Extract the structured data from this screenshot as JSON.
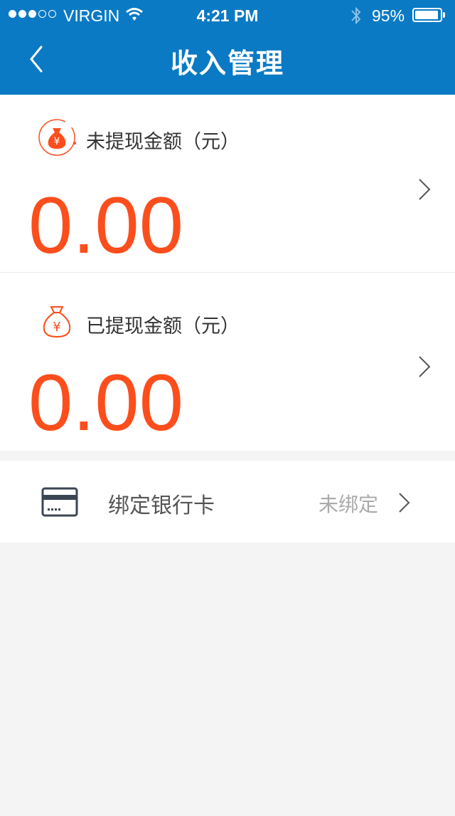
{
  "status_bar": {
    "carrier": "VIRGIN",
    "time": "4:21 PM",
    "battery": "95%",
    "battery_level": 0.95
  },
  "nav": {
    "title": "收入管理"
  },
  "cards": [
    {
      "label": "未提现金额（元）",
      "amount": "0.00"
    },
    {
      "label": "已提现金额（元）",
      "amount": "0.00"
    }
  ],
  "bank": {
    "label": "绑定银行卡",
    "status": "未绑定"
  },
  "colors": {
    "nav_blue": "#0a7ac4",
    "amount_orange": "#fc4e1c",
    "background": "#f4f4f4"
  }
}
